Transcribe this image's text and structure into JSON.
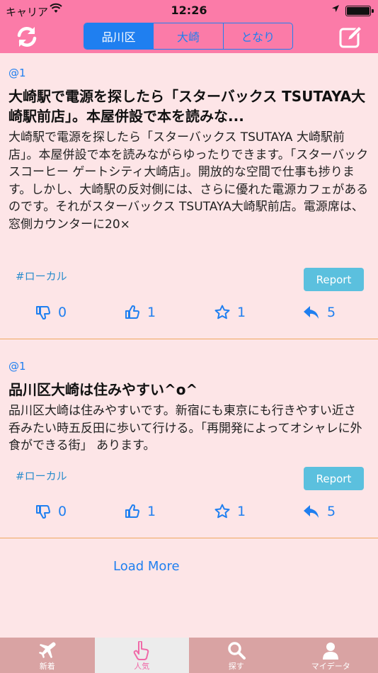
{
  "status_bar": {
    "carrier": "キャリア",
    "time": "12:26"
  },
  "nav": {
    "segments": [
      "品川区",
      "大崎",
      "となり"
    ],
    "active_segment": 0
  },
  "posts": [
    {
      "user": "@1",
      "title": "大崎駅で電源を探したら「スターバックス TSUTAYA大崎駅前店」。本屋併設で本を読みな...",
      "body": "大崎駅で電源を探したら「スターバックス TSUTAYA 大崎駅前店」。本屋併設で本を読みながらゆったりできます。「スターバックスコーヒー ゲートシティ大崎店」。開放的な空間で仕事も捗ります。しかし、大崎駅の反対側には、さらに優れた電源カフェがあるのです。それがスターバックス TSUTAYA大崎駅前店。電源席は、窓側カウンターに20×",
      "tag": "#ローカル",
      "report": "Report",
      "dislikes": "0",
      "likes": "1",
      "favorites": "1",
      "replies": "5"
    },
    {
      "user": "@1",
      "title": "品川区大崎は住みやすい^o^",
      "body": "品川区大崎は住みやすいです。新宿にも東京にも行きやすい近さ　呑みたい時五反田に歩いて行ける。「再開発によってオシャレに外食ができる街」 あります。",
      "tag": "#ローカル",
      "report": "Report",
      "dislikes": "0",
      "likes": "1",
      "favorites": "1",
      "replies": "5"
    }
  ],
  "load_more": "Load More",
  "tabs": [
    {
      "label": "新着",
      "icon": "airplane-icon"
    },
    {
      "label": "人気",
      "icon": "pointing-hand-icon"
    },
    {
      "label": "探す",
      "icon": "search-icon"
    },
    {
      "label": "マイデータ",
      "icon": "user-icon"
    }
  ],
  "active_tab": 1,
  "colors": {
    "header": "#fb7ba8",
    "background": "#fde5e7",
    "accent": "#1f7ff0",
    "report": "#5bc0de",
    "tabbar": "#d9a3a3"
  }
}
